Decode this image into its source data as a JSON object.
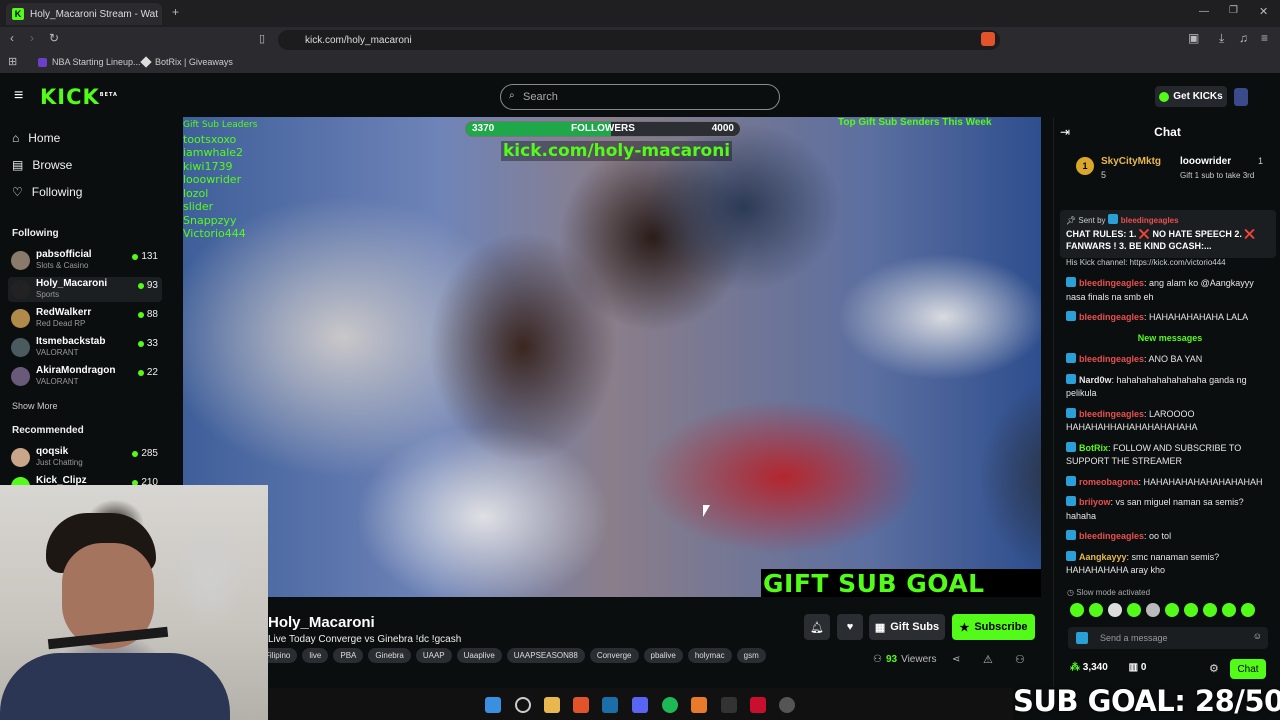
{
  "browser": {
    "tab_title": "Holy_Macaroni Stream - Wat",
    "url": "kick.com/holy_macaroni",
    "bookmarks": [
      "NBA Starting Lineup...",
      "BotRix | Giveaways"
    ]
  },
  "nav": {
    "logo": "KICK",
    "logo_badge": "BETA",
    "search_placeholder": "Search",
    "get_kicks": "Get KICKs"
  },
  "sidebar": {
    "home": "Home",
    "browse": "Browse",
    "following": "Following",
    "following_heading": "Following",
    "following_channels": [
      {
        "name": "pabsofficial",
        "category": "Slots & Casino",
        "viewers": "131"
      },
      {
        "name": "Holy_Macaroni",
        "category": "Sports",
        "viewers": "93"
      },
      {
        "name": "RedWalkerr",
        "category": "Red Dead RP",
        "viewers": "88"
      },
      {
        "name": "Itsmebackstab",
        "category": "VALORANT",
        "viewers": "33"
      },
      {
        "name": "AkiraMondragon",
        "category": "VALORANT",
        "viewers": "22"
      }
    ],
    "show_more": "Show More",
    "recommended_heading": "Recommended",
    "recommended_channels": [
      {
        "name": "qoqsik",
        "category": "Just Chatting",
        "viewers": "285"
      },
      {
        "name": "Kick_Clipz",
        "category": "",
        "viewers": "210"
      }
    ]
  },
  "video": {
    "gift_heading": "Gift Sub Leaders",
    "gift_list": [
      "tootsxoxo",
      "iamwhale2",
      "kiwi1739",
      "looowrider",
      "lozol",
      "slider",
      "Snappzyy",
      "Victorio444"
    ],
    "followers_label": "FOLLOWERS",
    "followers_current": "3370",
    "followers_goal": "4000",
    "followers_progress": 0.53,
    "kick_url": "kick.com/holy-macaroni",
    "top_gift": "Top Gift Sub Senders This Week",
    "sub_goal": "GIFT SUB GOAL 28/50"
  },
  "stream": {
    "streamer": "Holy_Macaroni",
    "title": "Live Today Converge vs Ginebra !dc !gcash",
    "tags": [
      "Filipino",
      "live",
      "PBA",
      "Ginebra",
      "UAAP",
      "Uaaplive",
      "UAAPSEASON88",
      "Converge",
      "pbalive",
      "holymac",
      "gsm"
    ],
    "gift_subs": "Gift Subs",
    "subscribe": "Subscribe",
    "viewers": "93",
    "viewers_label": "Viewers"
  },
  "chat": {
    "title": "Chat",
    "leader_name": "SkyCityMktg",
    "leader_count": "5",
    "leader_rank": "1",
    "second_name": "looowrider",
    "second_count": "1",
    "second_hint": "Gift 1 sub to take 3rd",
    "pinned_by_label": "Sent by",
    "pinned_by": "bleedingeagles",
    "pinned_text": "CHAT RULES: 1. ❌ NO HATE SPEECH 2. ❌ FANWARS ! 3. BE KIND GCASH:...",
    "partial_line": "His Kick channel: https://kick.com/victorio444",
    "messages_before": [
      {
        "user": "bleedingeagles",
        "text": "ang alam ko @Aangkayyy nasa finals na smb eh",
        "color": "#e84f4f"
      },
      {
        "user": "bleedingeagles",
        "text": "HAHAHAHAHAHA LALA",
        "color": "#e84f4f"
      }
    ],
    "new_messages": "New messages",
    "messages_after": [
      {
        "user": "bleedingeagles",
        "text": "ANO BA YAN",
        "color": "#e84f4f"
      },
      {
        "user": "Nard0w",
        "text": "hahahahahahahahaha ganda ng pelikula",
        "color": "#e6e6e6"
      },
      {
        "user": "bleedingeagles",
        "text": "LAROOOO HAHAHAHHAHAHAHAHAHAHA",
        "color": "#e84f4f"
      },
      {
        "user": "BotRix",
        "text": "FOLLOW AND SUBSCRIBE TO SUPPORT THE STREAMER",
        "color": "#53fc18"
      },
      {
        "user": "romeobagona",
        "text": "HAHAHAHAHAHAHAHAHAH",
        "color": "#e84f4f"
      },
      {
        "user": "briiyow",
        "text": "vs san miguel naman sa semis? hahaha",
        "color": "#e84f4f"
      },
      {
        "user": "bleedingeagles",
        "text": "oo tol",
        "color": "#e84f4f"
      },
      {
        "user": "Aangkayyy",
        "text": "smc nanaman semis? HAHAHAHAHA aray kho",
        "color": "#e8b84f"
      }
    ],
    "slow_mode": "Slow mode activated",
    "send_placeholder": "Send a message",
    "points": "3,340",
    "gift_count": "0",
    "chat_button": "Chat"
  },
  "overlay": {
    "bottom_goal": "SUB GOAL: 28/50"
  },
  "colors": {
    "kick_green": "#53fc18",
    "background": "#0b0e0f"
  }
}
